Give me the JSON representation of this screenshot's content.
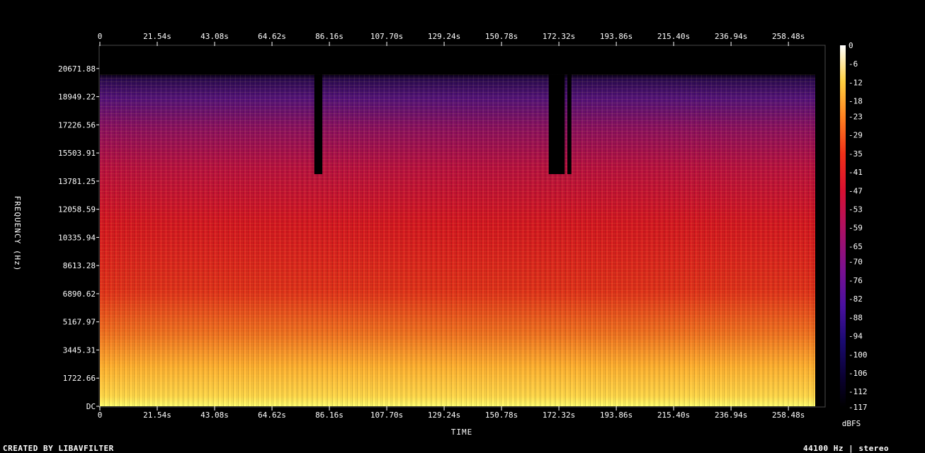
{
  "chart_data": {
    "type": "heatmap",
    "xlabel": "TIME",
    "ylabel": "FREQUENCY (Hz)",
    "x_unit": "s",
    "xlim": [
      0,
      272
    ],
    "ylim": [
      0,
      22050
    ],
    "x_ticks": [
      "0",
      "21.54s",
      "43.08s",
      "64.62s",
      "86.16s",
      "107.70s",
      "129.24s",
      "150.78s",
      "172.32s",
      "193.86s",
      "215.40s",
      "236.94s",
      "258.48s"
    ],
    "x_tick_values": [
      0,
      21.54,
      43.08,
      64.62,
      86.16,
      107.7,
      129.24,
      150.78,
      172.32,
      193.86,
      215.4,
      236.94,
      258.48
    ],
    "y_ticks": [
      "DC",
      "1722.66",
      "3445.31",
      "5167.97",
      "6890.62",
      "8613.28",
      "10335.94",
      "12058.59",
      "13781.25",
      "15503.91",
      "17226.56",
      "18949.22",
      "20671.88"
    ],
    "y_tick_values": [
      0,
      1722.66,
      3445.31,
      5167.97,
      6890.62,
      8613.28,
      10335.94,
      12058.59,
      13781.25,
      15503.91,
      17226.56,
      18949.22,
      20671.88
    ],
    "colorbar": {
      "label": "dBFS",
      "ticks": [
        "0",
        "-6",
        "-12",
        "-18",
        "-23",
        "-29",
        "-35",
        "-41",
        "-47",
        "-53",
        "-59",
        "-65",
        "-70",
        "-76",
        "-82",
        "-88",
        "-94",
        "-100",
        "-106",
        "-112",
        "-117"
      ],
      "tick_values": [
        0,
        -6,
        -12,
        -18,
        -23,
        -29,
        -35,
        -41,
        -47,
        -53,
        -59,
        -65,
        -70,
        -76,
        -82,
        -88,
        -94,
        -100,
        -106,
        -112,
        -117
      ],
      "range": [
        -117,
        0
      ]
    },
    "energy_profile_cutoff_hz": 20300,
    "gaps_seconds": [
      [
        80.5,
        83.5
      ],
      [
        168.5,
        174.5
      ],
      [
        175.5,
        177.0
      ]
    ],
    "colors": {
      "background": "#000000",
      "axis": "#ffffff",
      "frame": "#4a4a4a"
    }
  },
  "footer": {
    "left": "CREATED BY LIBAVFILTER",
    "right": "44100 Hz | stereo"
  }
}
